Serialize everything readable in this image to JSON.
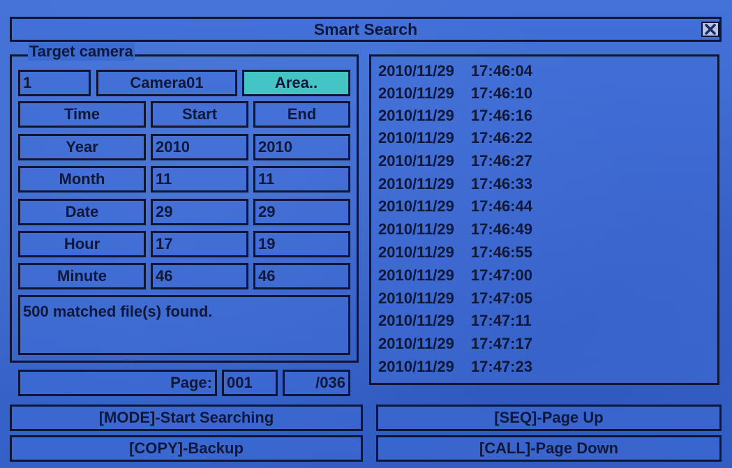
{
  "window": {
    "title": "Smart Search"
  },
  "target": {
    "legend": "Target camera",
    "camera_number": "1",
    "camera_name": "Camera01",
    "area_button": "Area.."
  },
  "table": {
    "headers": {
      "field": "Time",
      "start": "Start",
      "end": "End"
    },
    "rows": [
      {
        "label": "Year",
        "start": "2010",
        "end": "2010"
      },
      {
        "label": "Month",
        "start": "11",
        "end": "11"
      },
      {
        "label": "Date",
        "start": "29",
        "end": "29"
      },
      {
        "label": "Hour",
        "start": "17",
        "end": "19"
      },
      {
        "label": "Minute",
        "start": "46",
        "end": "46"
      }
    ]
  },
  "status_message": "500 matched file(s) found.",
  "pager": {
    "label": "Page:",
    "current": "001",
    "total": "/036"
  },
  "results": [
    {
      "date": "2010/11/29",
      "time": "17:46:04"
    },
    {
      "date": "2010/11/29",
      "time": "17:46:10"
    },
    {
      "date": "2010/11/29",
      "time": "17:46:16"
    },
    {
      "date": "2010/11/29",
      "time": "17:46:22"
    },
    {
      "date": "2010/11/29",
      "time": "17:46:27"
    },
    {
      "date": "2010/11/29",
      "time": "17:46:33"
    },
    {
      "date": "2010/11/29",
      "time": "17:46:44"
    },
    {
      "date": "2010/11/29",
      "time": "17:46:49"
    },
    {
      "date": "2010/11/29",
      "time": "17:46:55"
    },
    {
      "date": "2010/11/29",
      "time": "17:47:00"
    },
    {
      "date": "2010/11/29",
      "time": "17:47:05"
    },
    {
      "date": "2010/11/29",
      "time": "17:47:11"
    },
    {
      "date": "2010/11/29",
      "time": "17:47:17"
    },
    {
      "date": "2010/11/29",
      "time": "17:47:23"
    }
  ],
  "actions": {
    "start_search": "[MODE]-Start Searching",
    "page_up": "[SEQ]-Page Up",
    "backup": "[COPY]-Backup",
    "page_down": "[CALL]-Page Down"
  },
  "colors": {
    "background": "#3b68cf",
    "border": "#0f1633",
    "highlight": "#45c4c6"
  },
  "icons": {
    "close": "close-icon"
  }
}
